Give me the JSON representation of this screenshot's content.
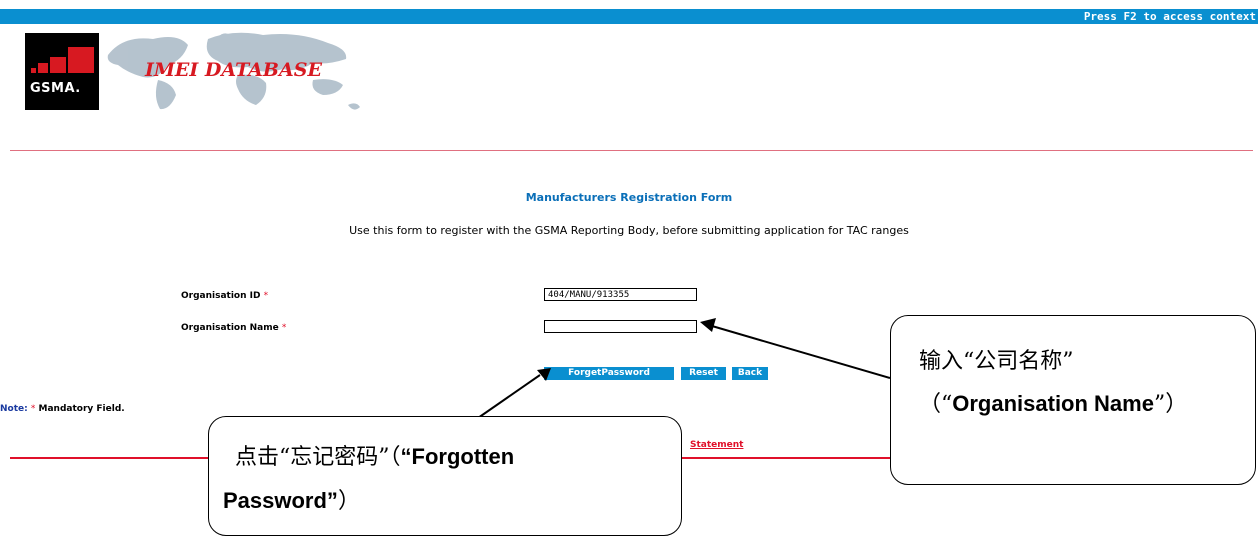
{
  "header": {
    "context_text": "Press F2 to access context",
    "logo_text": "GSMA.",
    "title": "IMEI DATABASE"
  },
  "form": {
    "title": "Manufacturers Registration Form",
    "description": "Use this form to register with the GSMA Reporting Body, before submitting application for TAC ranges",
    "fields": [
      {
        "label": "Organisation ID",
        "required_mark": "*",
        "value": "404/MANU/913355"
      },
      {
        "label": "Organisation Name",
        "required_mark": "*",
        "value": ""
      }
    ],
    "buttons": {
      "forget_password": "ForgetPassword",
      "reset": "Reset",
      "back": "Back"
    },
    "note_label": "Note:",
    "note_star": "*",
    "note_text": "Mandatory Field.",
    "statement_link": "Statement"
  },
  "annotations": {
    "name_callout_line1": "输入“公司名称”",
    "name_callout_open": "（“",
    "name_callout_bold": "Organisation Name",
    "name_callout_close": "”）",
    "forgot_callout_line1_cn": "点击“忘记密码”（",
    "forgot_callout_line1_bold": "“Forgotten",
    "forgot_callout_line2_bold": "Password”",
    "forgot_callout_line2_close": "）"
  },
  "colors": {
    "header_bar": "#0a8fd0",
    "brand_red": "#d71921",
    "title_blue": "#0a6fb8"
  }
}
